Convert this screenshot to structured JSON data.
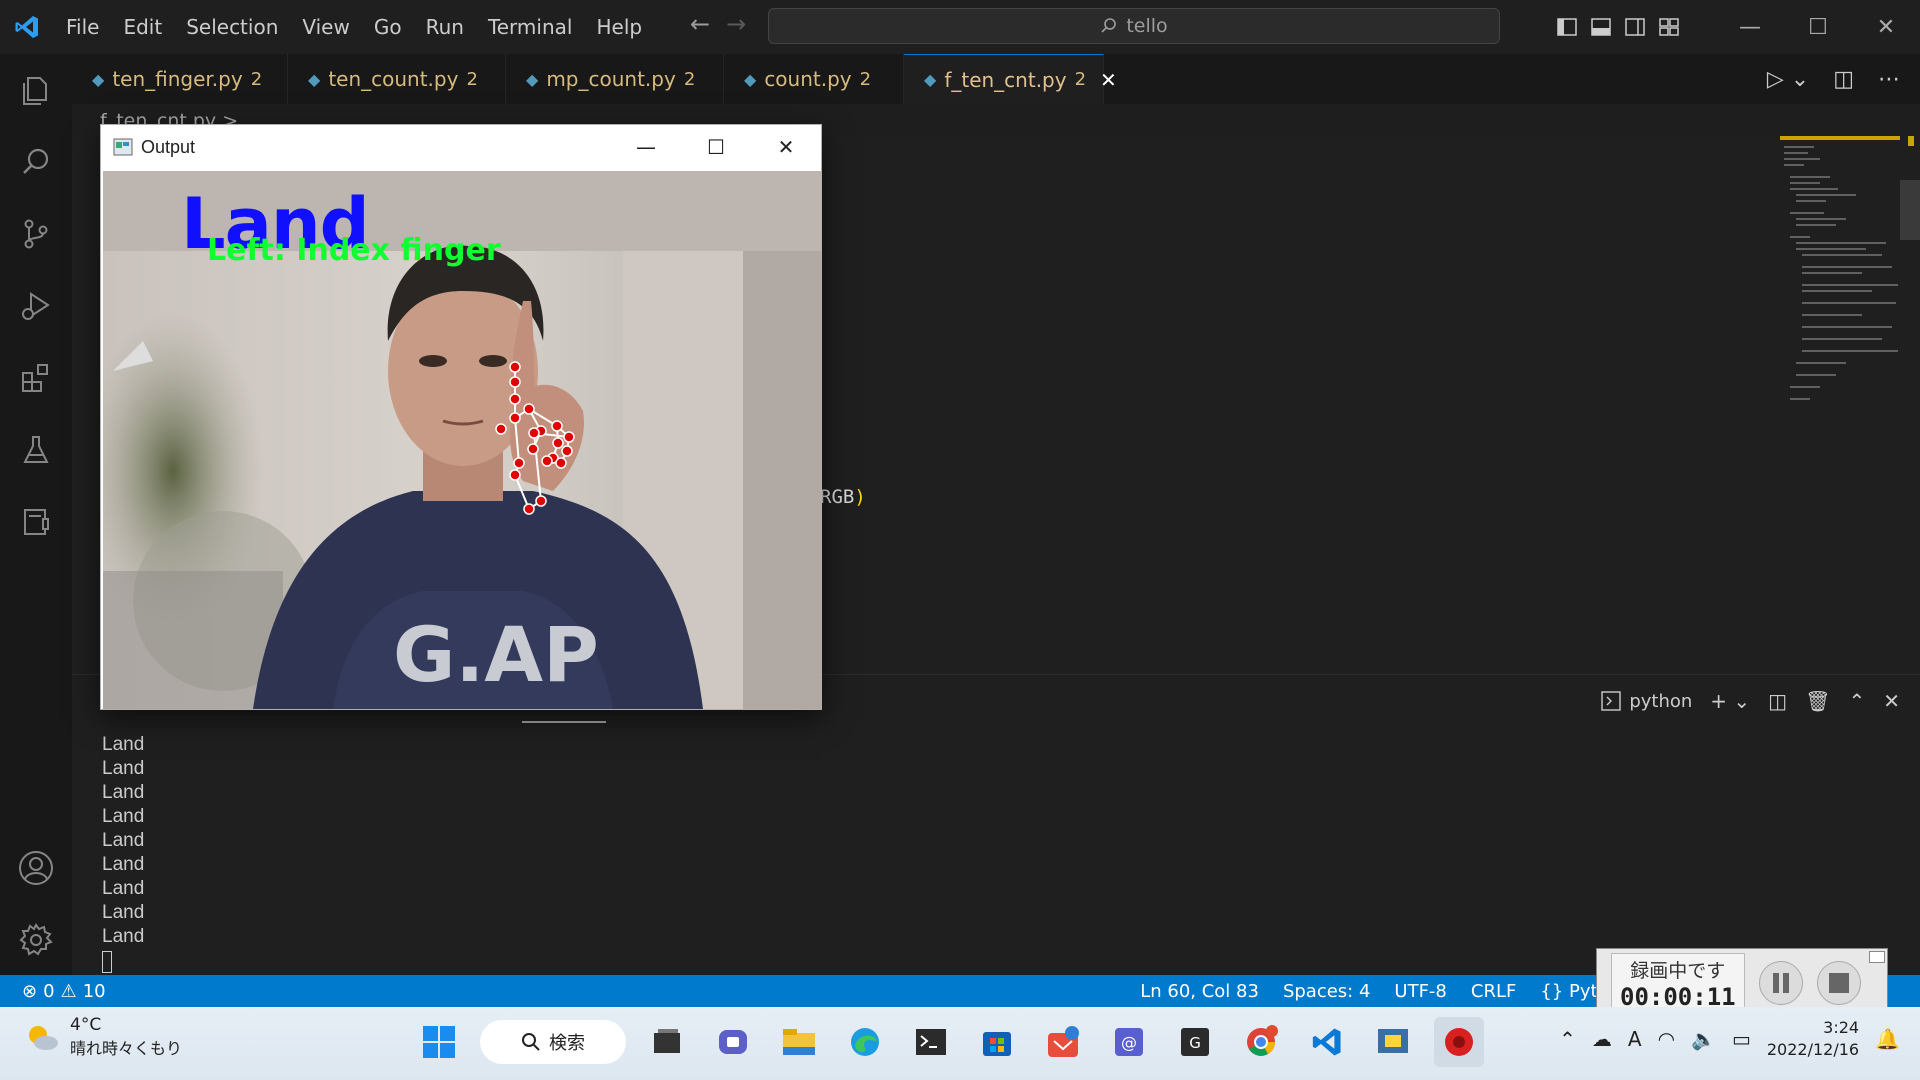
{
  "titlebar": {
    "menu": [
      "File",
      "Edit",
      "Selection",
      "View",
      "Go",
      "Run",
      "Terminal",
      "Help"
    ],
    "search": "tello"
  },
  "tabs": [
    {
      "label": "ten_finger.py",
      "count": "2"
    },
    {
      "label": "ten_count.py",
      "count": "2"
    },
    {
      "label": "mp_count.py",
      "count": "2"
    },
    {
      "label": "count.py",
      "count": "2"
    },
    {
      "label": "f_ten_cnt.py",
      "count": "2"
    }
  ],
  "breadcrumb": "f_ten_cnt.py >",
  "editor": {
    "code_fragment": "RGB",
    "paren": ")"
  },
  "output_window": {
    "title": "Output",
    "overlay_big": "Land",
    "overlay_small": "Left: Index finger"
  },
  "panel": {
    "terminal_name": "python",
    "lines": [
      "Land",
      "Land",
      "Land",
      "Land",
      "Land",
      "Land",
      "Land",
      "Land",
      "Land"
    ]
  },
  "statusbar": {
    "errors": "0",
    "warnings": "10",
    "position": "Ln 60, Col 83",
    "spaces": "Spaces: 4",
    "encoding": "UTF-8",
    "eol": "CRLF",
    "language": "Pytho"
  },
  "recording": {
    "label": "録画中です",
    "time": "00:00:11"
  },
  "taskbar": {
    "temp": "4°C",
    "weather": "晴れ時々くもり",
    "search": "検索",
    "time": "3:24",
    "date": "2022/12/16"
  },
  "colors": {
    "accent": "#007acc",
    "tab_text": "#d7ba7d",
    "overlay_blue": "#1010ff",
    "overlay_green": "#10ff30",
    "landmark_red": "#e00000"
  }
}
